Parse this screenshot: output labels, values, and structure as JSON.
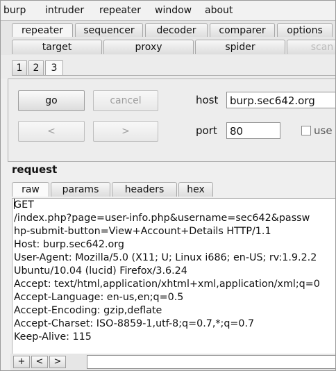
{
  "menu": [
    "burp",
    "intruder",
    "repeater",
    "window",
    "about"
  ],
  "main_tabs_row1": [
    "repeater",
    "sequencer",
    "decoder",
    "comparer",
    "options"
  ],
  "main_tabs_row2": [
    "target",
    "proxy",
    "spider",
    "scan"
  ],
  "sub_tabs": [
    "1",
    "2",
    "3"
  ],
  "controls": {
    "go_label": "go",
    "cancel_label": "cancel",
    "back_label": "<",
    "forward_label": ">",
    "host_label": "host",
    "host_value": "burp.sec642.org",
    "port_label": "port",
    "port_value": "80",
    "use_label": "use"
  },
  "request": {
    "title": "request",
    "tabs": [
      "raw",
      "params",
      "headers",
      "hex"
    ],
    "lines": [
      "GET",
      "/index.php?page=user-info.php&username=sec642&passw",
      "hp-submit-button=View+Account+Details HTTP/1.1",
      "Host: burp.sec642.org",
      "User-Agent: Mozilla/5.0 (X11; U; Linux i686; en-US; rv:1.9.2.2",
      "Ubuntu/10.04 (lucid) Firefox/3.6.24",
      "Accept: text/html,application/xhtml+xml,application/xml;q=0",
      "Accept-Language: en-us,en;q=0.5",
      "Accept-Encoding: gzip,deflate",
      "Accept-Charset: ISO-8859-1,utf-8;q=0.7,*;q=0.7",
      "Keep-Alive: 115"
    ]
  },
  "search": {
    "plus": "+",
    "prev": "<",
    "next": ">"
  }
}
